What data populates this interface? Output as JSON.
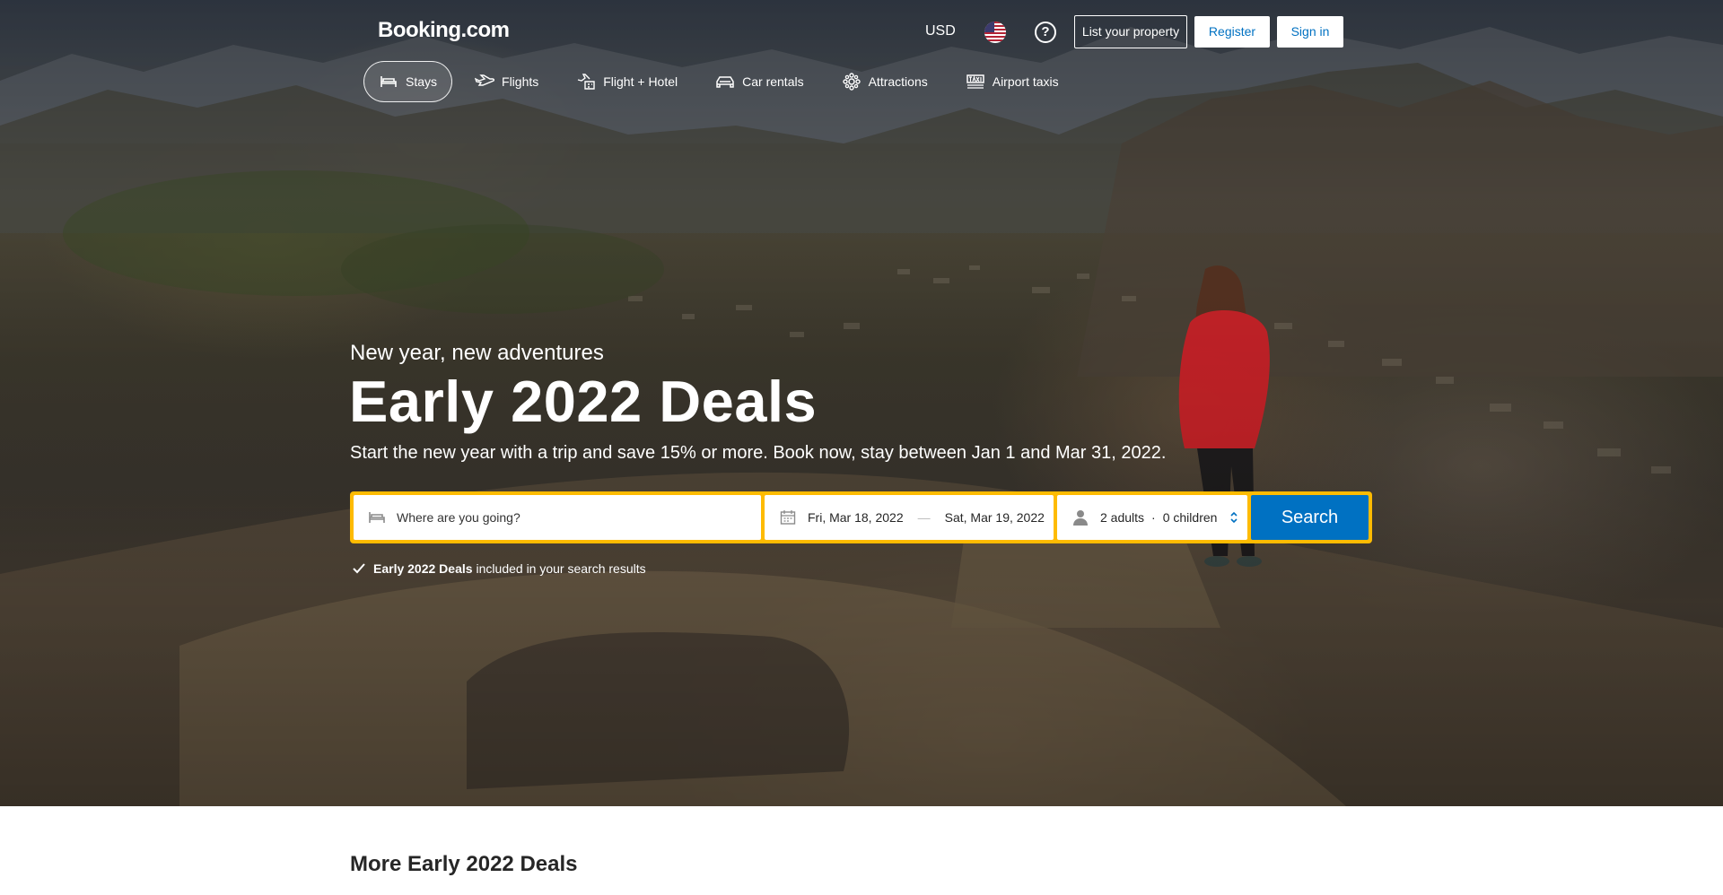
{
  "header": {
    "logo": "Booking.com",
    "currency": "USD",
    "flag_icon": "us-flag-icon",
    "help_icon": "question-circle-icon",
    "list_property": "List your property",
    "register": "Register",
    "sign_in": "Sign in"
  },
  "nav": {
    "items": [
      {
        "label": "Stays",
        "icon": "bed-icon",
        "active": true
      },
      {
        "label": "Flights",
        "icon": "plane-icon",
        "active": false
      },
      {
        "label": "Flight + Hotel",
        "icon": "flight-hotel-icon",
        "active": false
      },
      {
        "label": "Car rentals",
        "icon": "car-icon",
        "active": false
      },
      {
        "label": "Attractions",
        "icon": "attractions-icon",
        "active": false
      },
      {
        "label": "Airport taxis",
        "icon": "taxi-icon",
        "active": false
      }
    ]
  },
  "hero": {
    "eyebrow": "New year, new adventures",
    "title": "Early 2022 Deals",
    "subtitle": "Start the new year with a trip and save 15% or more. Book now, stay between Jan 1 and Mar 31, 2022."
  },
  "search": {
    "destination_placeholder": "Where are you going?",
    "destination_value": "",
    "checkin": "Fri, Mar 18, 2022",
    "date_separator": "—",
    "checkout": "Sat, Mar 19, 2022",
    "adults": "2 adults",
    "guest_separator": "·",
    "children": "0 children",
    "button": "Search"
  },
  "included_note": {
    "bold": "Early 2022 Deals",
    "rest": "included in your search results"
  },
  "section": {
    "title": "More Early 2022 Deals"
  },
  "colors": {
    "brand_blue": "#0071c2",
    "search_border": "#febb02",
    "header_text": "#ffffff"
  }
}
